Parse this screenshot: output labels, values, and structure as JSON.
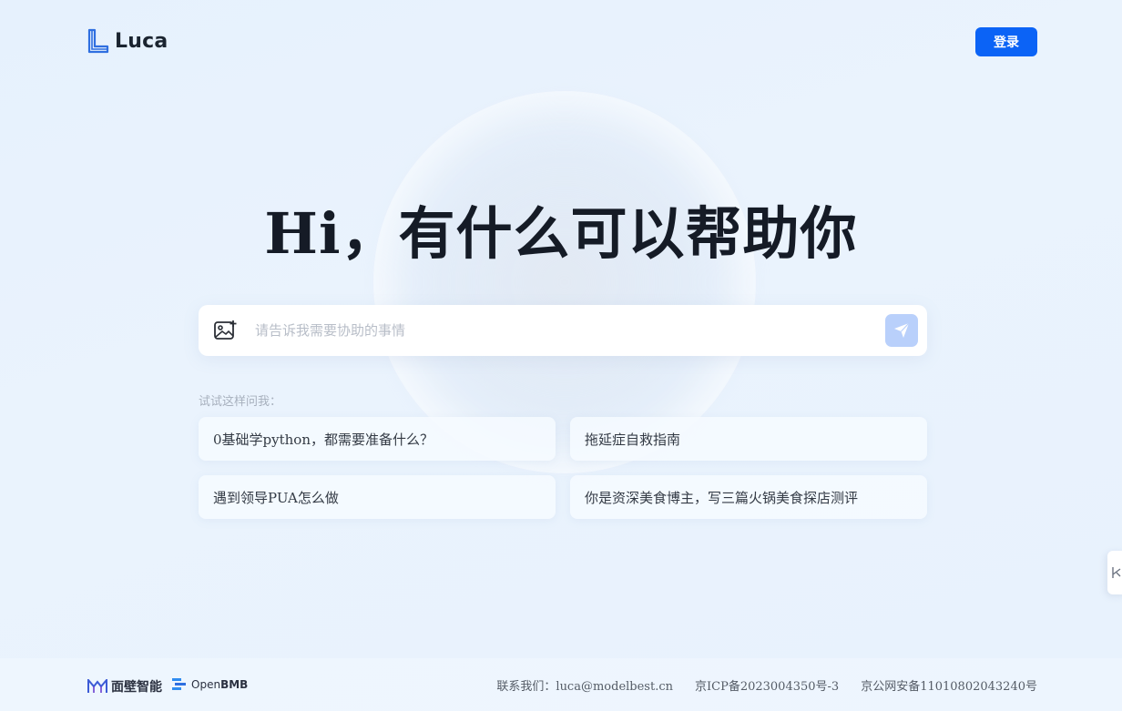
{
  "header": {
    "logo_text": "Luca",
    "login_label": "登录"
  },
  "hero": {
    "title": "Hi，有什么可以帮助你"
  },
  "input": {
    "placeholder": "请告诉我需要协助的事情"
  },
  "suggestions": {
    "label": "试试这样问我：",
    "items": [
      "0基础学python，都需要准备什么？",
      "拖延症自救指南",
      "遇到领导PUA怎么做",
      "你是资深美食博主，写三篇火锅美食探店测评"
    ]
  },
  "footer": {
    "brand1": "面壁智能",
    "brand2_prefix": "Open",
    "brand2_suffix": "BMB",
    "contact": "联系我们：luca@modelbest.cn",
    "icp": "京ICP备2023004350号-3",
    "police": "京公网安备11010802043240号"
  },
  "colors": {
    "accent": "#0b63f6",
    "send_disabled": "#b9d0fb"
  },
  "icons": [
    "luca-logo-icon",
    "image-upload-icon",
    "send-icon",
    "side-expand-icon",
    "mianbi-logo-icon",
    "openbmb-logo-icon"
  ]
}
